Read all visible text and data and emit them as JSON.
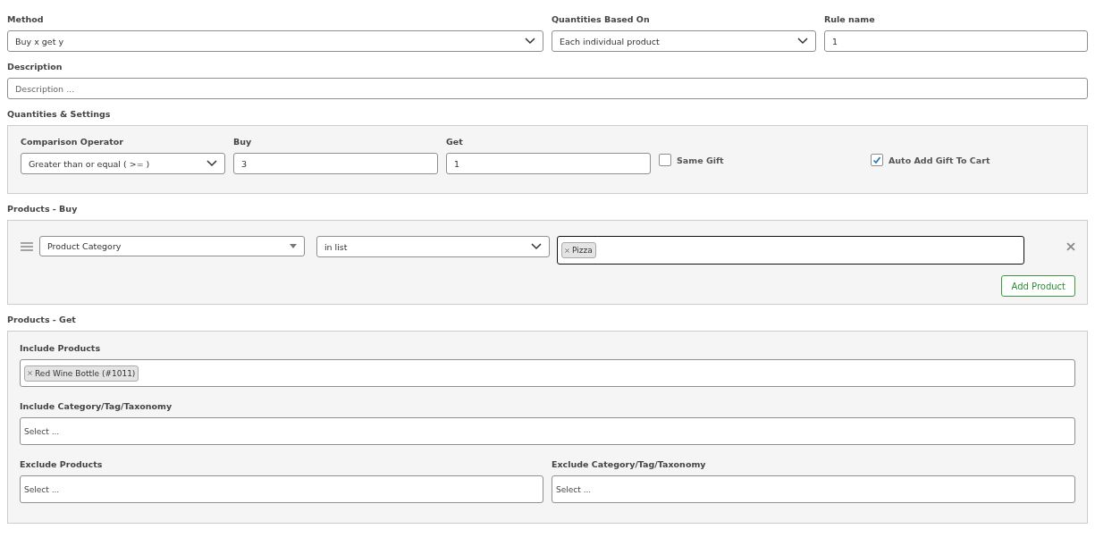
{
  "top_fields": [
    {
      "label": "Method",
      "kind": "select",
      "value": "Buy x get y"
    },
    {
      "label": "Quantities Based On",
      "kind": "select",
      "value": "Each individual product"
    },
    {
      "label": "Rule name",
      "kind": "text",
      "value": "1"
    }
  ],
  "description": {
    "label": "Description",
    "placeholder": "Description ..."
  },
  "quantities": {
    "title": "Quantities & Settings",
    "fields": [
      {
        "label": "Comparison Operator",
        "kind": "select",
        "value": "Greater than or equal ( >= )"
      },
      {
        "label": "Buy",
        "kind": "text",
        "value": "3"
      },
      {
        "label": "Get",
        "kind": "text",
        "value": "1"
      }
    ],
    "checkboxes": [
      {
        "label": "Same Gift",
        "checked": false
      },
      {
        "label": "Auto Add Gift To Cart",
        "checked": true
      }
    ]
  },
  "products_buy": {
    "title": "Products - Buy",
    "rules": [
      {
        "field": "Product Category",
        "operator": "in list",
        "tags": [
          "Pizza"
        ]
      }
    ],
    "add_button": "Add Product"
  },
  "products_get": {
    "title": "Products - Get",
    "include_products": {
      "label": "Include Products",
      "tags": [
        "Red Wine Bottle (#1011)"
      ]
    },
    "include_category": {
      "label": "Include Category/Tag/Taxonomy",
      "placeholder": "Select ..."
    },
    "exclude": [
      {
        "label": "Exclude Products",
        "placeholder": "Select ..."
      },
      {
        "label": "Exclude Category/Tag/Taxonomy",
        "placeholder": "Select ..."
      }
    ]
  }
}
